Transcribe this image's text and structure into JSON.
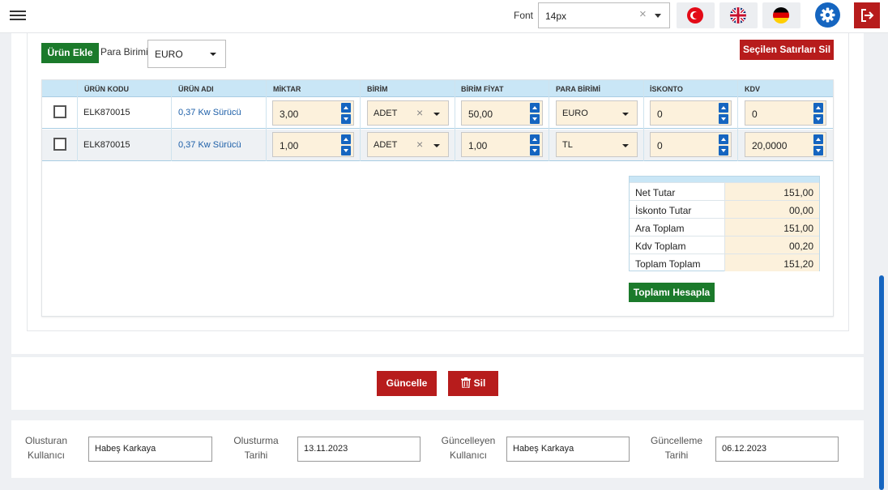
{
  "header": {
    "font_label": "Font",
    "font_value": "14px",
    "languages": [
      "turkish-flag-icon",
      "english-flag-icon",
      "german-flag-icon"
    ]
  },
  "toolbar": {
    "add_product": "Ürün Ekle",
    "currency_label": "Para Birimi",
    "currency_value": "EURO",
    "delete_selected": "Seçilen Satırları Sil"
  },
  "table": {
    "columns": [
      "ÜRÜN KODU",
      "ÜRÜN ADI",
      "MİKTAR",
      "BİRİM",
      "BİRİM FİYAT",
      "PARA BİRİMİ",
      "İSKONTO",
      "KDV"
    ],
    "rows": [
      {
        "code": "ELK870015",
        "name": "0,37 Kw Sürücü",
        "qty": "3,00",
        "unit": "ADET",
        "price": "50,00",
        "currency": "EURO",
        "discount": "0",
        "vat": "0"
      },
      {
        "code": "ELK870015",
        "name": "0,37 Kw Sürücü",
        "qty": "1,00",
        "unit": "ADET",
        "price": "1,00",
        "currency": "TL",
        "discount": "0",
        "vat": "20,0000"
      }
    ]
  },
  "totals": [
    {
      "label": "Net Tutar",
      "value": "151,00"
    },
    {
      "label": "İskonto Tutar",
      "value": "00,00"
    },
    {
      "label": "Ara Toplam",
      "value": "151,00"
    },
    {
      "label": "Kdv Toplam",
      "value": "00,20"
    },
    {
      "label": "Toplam Toplam",
      "value": "151,20"
    }
  ],
  "calc_button": "Toplamı Hesapla",
  "actions": {
    "update": "Güncelle",
    "delete": "Sil"
  },
  "audit": {
    "created_by_label_1": "Olusturan",
    "created_by_label_2": "Kullanıcı",
    "created_by": "Habeş Karkaya",
    "created_at_label_1": "Olusturma",
    "created_at_label_2": "Tarihi",
    "created_at": "13.11.2023",
    "updated_by_label_1": "Güncelleyen",
    "updated_by_label_2": "Kullanıcı",
    "updated_by": "Habeş Karkaya",
    "updated_at_label_1": "Güncelleme",
    "updated_at_label_2": "Tarihi",
    "updated_at": "06.12.2023"
  },
  "colors": {
    "primary": "#1565c0",
    "success": "#1b7a2b",
    "danger": "#b71c1c",
    "header_row": "#c9e6f6",
    "input_bg": "#fcf1dc"
  }
}
